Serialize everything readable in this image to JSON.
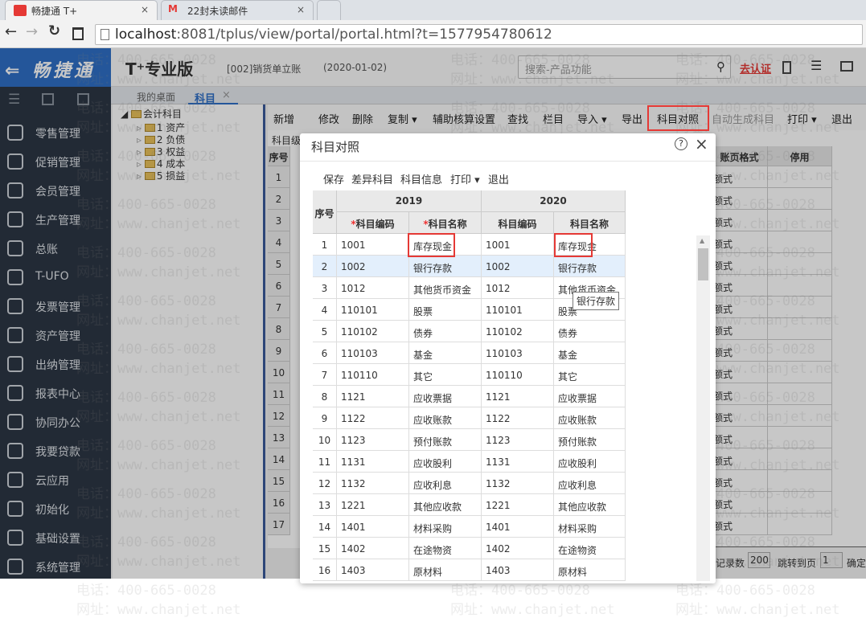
{
  "browser": {
    "tabs": [
      {
        "title": "畅捷通 T+",
        "close": "×"
      },
      {
        "title": "22封未读邮件",
        "close": "×"
      }
    ],
    "url_host": "localhost",
    "url_rest": ":8081/tplus/view/portal/portal.html?t=1577954780612"
  },
  "watermark": {
    "phone": "电话：400-665-0028",
    "site": "网址：www.chanjet.net"
  },
  "header": {
    "brand": "⇐ 畅捷通",
    "product": "T⁺专业版",
    "account": "[002]销货单立账",
    "date": "(2020-01-02)",
    "search_placeholder": "搜索-产品功能",
    "certify": "去认证"
  },
  "sidebar": {
    "items": [
      "零售管理",
      "促销管理",
      "会员管理",
      "生产管理",
      "总账",
      "T-UFO",
      "发票管理",
      "资产管理",
      "出纳管理",
      "报表中心",
      "协同办公",
      "我要贷款",
      "云应用",
      "初始化",
      "基础设置",
      "系统管理"
    ]
  },
  "tabs": [
    {
      "label": "我的桌面"
    },
    {
      "label": "科目",
      "close": "×"
    }
  ],
  "tree": {
    "root": "会计科目",
    "children": [
      "1 资产",
      "2 负债",
      "3 权益",
      "4 成本",
      "5 损益"
    ]
  },
  "toolbar": [
    "新增",
    "修改",
    "删除",
    "复制 ▾",
    "辅助核算设置",
    "查找",
    "栏目",
    "导入 ▾",
    "导出",
    "科目对照",
    "自动生成科目",
    "打印 ▾",
    "退出"
  ],
  "grid": {
    "level_label": "科目级",
    "col_seq": "序号",
    "col_format": "账页格式",
    "col_disabled": "停用",
    "format_value": "额式",
    "rows": 17
  },
  "pager": {
    "records_label": "记录数",
    "records": "200",
    "goto_label": "跳转到页",
    "page": "1",
    "confirm": "确定"
  },
  "modal": {
    "title": "科目对照",
    "help": "?",
    "close": "×",
    "toolbar": [
      "保存",
      "差异科目",
      "科目信息",
      "打印 ▾",
      "退出"
    ],
    "headers": {
      "seq": "序号",
      "y2019": "2019",
      "y2020": "2020",
      "code": "科目编码",
      "name": "科目名称",
      "req": "*"
    },
    "rows": [
      [
        "1",
        "1001",
        "库存现金",
        "1001",
        "库存现金"
      ],
      [
        "2",
        "1002",
        "银行存款",
        "1002",
        "银行存款"
      ],
      [
        "3",
        "1012",
        "其他货币资金",
        "1012",
        "其他货币资金"
      ],
      [
        "4",
        "110101",
        "股票",
        "110101",
        "股票"
      ],
      [
        "5",
        "110102",
        "债券",
        "110102",
        "债券"
      ],
      [
        "6",
        "110103",
        "基金",
        "110103",
        "基金"
      ],
      [
        "7",
        "110110",
        "其它",
        "110110",
        "其它"
      ],
      [
        "8",
        "1121",
        "应收票据",
        "1121",
        "应收票据"
      ],
      [
        "9",
        "1122",
        "应收账款",
        "1122",
        "应收账款"
      ],
      [
        "10",
        "1123",
        "预付账款",
        "1123",
        "预付账款"
      ],
      [
        "11",
        "1131",
        "应收股利",
        "1131",
        "应收股利"
      ],
      [
        "12",
        "1132",
        "应收利息",
        "1132",
        "应收利息"
      ],
      [
        "13",
        "1221",
        "其他应收款",
        "1221",
        "其他应收款"
      ],
      [
        "14",
        "1401",
        "材料采购",
        "1401",
        "材料采购"
      ],
      [
        "15",
        "1402",
        "在途物资",
        "1402",
        "在途物资"
      ],
      [
        "16",
        "1403",
        "原材料",
        "1403",
        "原材料"
      ]
    ],
    "tooltip": "银行存款"
  }
}
